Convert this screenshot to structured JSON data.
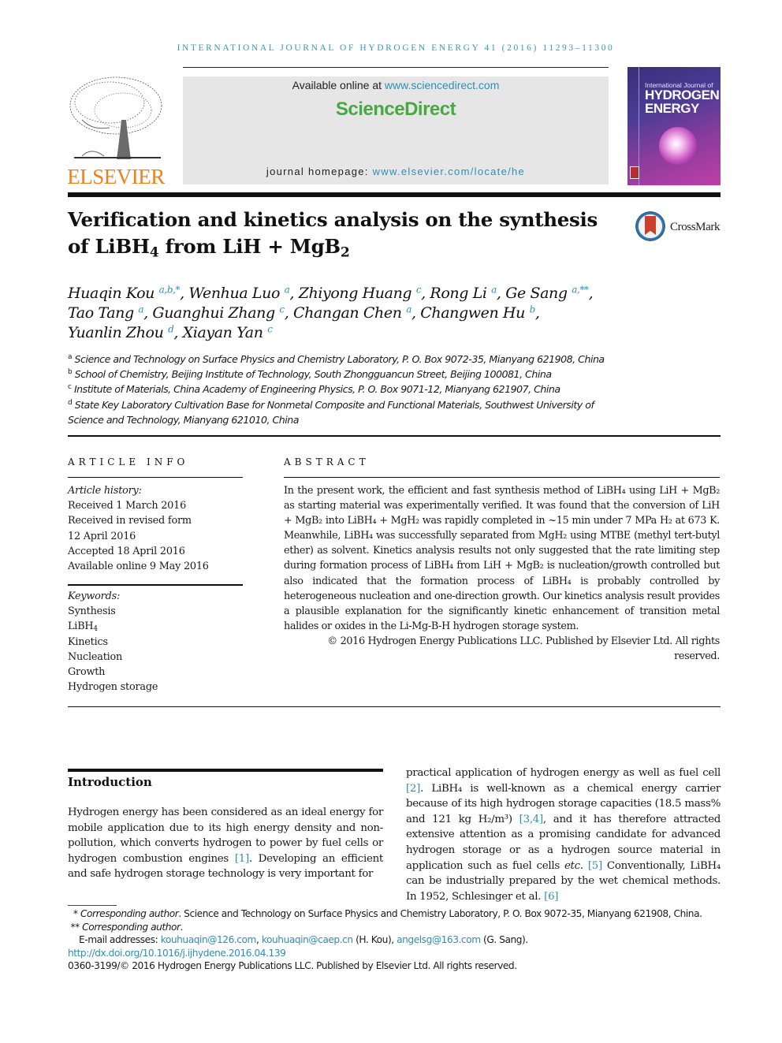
{
  "running_head": "INTERNATIONAL JOURNAL OF HYDROGEN ENERGY 41 (2016) 11293–11300",
  "masthead": {
    "publisher_logo": "ELSEVIER",
    "available_online_prefix": "Available online at ",
    "available_online_link": "www.sciencedirect.com",
    "brand": "ScienceDirect",
    "homepage_prefix": "journal homepage: ",
    "homepage_link": "www.elsevier.com/locate/he",
    "cover": {
      "line1": "International Journal of",
      "line2": "HYDROGEN",
      "line3": "ENERGY"
    },
    "colors": {
      "link": "#2e8fb5",
      "brand_green": "#48a842",
      "elsevier_orange": "#f07f1a"
    }
  },
  "article": {
    "title_part1": "Verification and kinetics analysis on the synthesis of LiBH",
    "title_sub1": "4",
    "title_part2": " from LiH + MgB",
    "title_sub2": "2",
    "crossmark_label": "CrossMark",
    "authors": [
      {
        "name": "Huaqin Kou",
        "aff": "a,b,*",
        "sep": ", "
      },
      {
        "name": "Wenhua Luo",
        "aff": "a",
        "sep": ", "
      },
      {
        "name": "Zhiyong Huang",
        "aff": "c",
        "sep": ", "
      },
      {
        "name": "Rong Li",
        "aff": "a",
        "sep": ", "
      },
      {
        "name": "Ge Sang",
        "aff": "a,**",
        "sep": ","
      },
      {
        "name": "Tao Tang",
        "aff": "a",
        "sep": ", "
      },
      {
        "name": "Guanghui Zhang",
        "aff": "c",
        "sep": ", "
      },
      {
        "name": "Changan Chen",
        "aff": "a",
        "sep": ", "
      },
      {
        "name": "Changwen Hu",
        "aff": "b",
        "sep": ","
      },
      {
        "name": "Yuanlin Zhou",
        "aff": "d",
        "sep": ", "
      },
      {
        "name": "Xiayan Yan",
        "aff": "c",
        "sep": ""
      }
    ],
    "affiliations": [
      {
        "key": "a",
        "text": "Science and Technology on Surface Physics and Chemistry Laboratory, P. O. Box 9072-35, Mianyang 621908, China"
      },
      {
        "key": "b",
        "text": "School of Chemistry, Beijing Institute of Technology, South Zhongguancun Street, Beijing 100081, China"
      },
      {
        "key": "c",
        "text": "Institute of Materials, China Academy of Engineering Physics, P. O. Box 9071-12, Mianyang 621907, China"
      },
      {
        "key": "d",
        "text": "State Key Laboratory Cultivation Base for Nonmetal Composite and Functional Materials, Southwest University of Science and Technology, Mianyang 621010, China"
      }
    ]
  },
  "article_info": {
    "heading": "ARTICLE INFO",
    "history_label": "Article history:",
    "history": [
      "Received 1 March 2016",
      "Received in revised form",
      "12 April 2016",
      "Accepted 18 April 2016",
      "Available online 9 May 2016"
    ],
    "keywords_label": "Keywords:",
    "keywords": [
      "Synthesis",
      "LiBH4",
      "Kinetics",
      "Nucleation",
      "Growth",
      "Hydrogen storage"
    ]
  },
  "abstract": {
    "heading": "ABSTRACT",
    "text": "In the present work, the efficient and fast synthesis method of LiBH₄ using LiH + MgB₂ as starting material was experimentally verified. It was found that the conversion of LiH + MgB₂ into LiBH₄ + MgH₂ was rapidly completed in ~15 min under 7 MPa H₂ at 673 K. Meanwhile, LiBH₄ was successfully separated from MgH₂ using MTBE (methyl tert-butyl ether) as solvent. Kinetics analysis results not only suggested that the rate limiting step during formation process of LiBH₄ from LiH + MgB₂ is nucleation/growth controlled but also indicated that the formation process of LiBH₄ is probably controlled by heterogeneous nucleation and one-direction growth. Our kinetics analysis result provides a plausible explanation for the significantly kinetic enhancement of transition metal halides or oxides in the Li-Mg-B-H hydrogen storage system.",
    "copyright": "© 2016 Hydrogen Energy Publications LLC. Published by Elsevier Ltd. All rights reserved."
  },
  "introduction": {
    "heading": "Introduction",
    "left_p1": "Hydrogen energy has been considered as an ideal energy for mobile application due to its high energy density and non-pollution, which converts hydrogen to power by fuel cells or hydrogen combustion engines ",
    "left_ref1": "[1]",
    "left_p2": ". Developing an efficient and safe hydrogen storage technology is very important for",
    "right_p1": "practical application of hydrogen energy as well as fuel cell ",
    "right_ref2": "[2]",
    "right_p2": ". LiBH₄ is well-known as a chemical energy carrier because of its high hydrogen storage capacities (18.5 mass% and 121 kg H₂/m³) ",
    "right_ref34": "[3,4]",
    "right_p3": ", and it has therefore attracted extensive attention as a promising candidate for advanced hydrogen storage or as a hydrogen source material in application such as fuel cells ",
    "right_etc": "etc.",
    "right_ref5": "[5]",
    "right_p4": " Conventionally, LiBH₄ can be industrially prepared by the wet chemical methods. In 1952, Schlesinger et al. ",
    "right_ref6": "[6]"
  },
  "footnotes": {
    "fn1_mark": "*",
    "fn1_label": "Corresponding author",
    "fn1_text": ". Science and Technology on Surface Physics and Chemistry Laboratory, P. O. Box 9072-35, Mianyang 621908, China.",
    "fn2_mark": "**",
    "fn2_label": "Corresponding author",
    "fn2_text": ".",
    "email_prefix": "E-mail addresses: ",
    "email1": "kouhuaqin@126.com",
    "email2": "kouhuaqin@caep.cn",
    "email_kou": " (H. Kou), ",
    "email3": "angelsg@163.com",
    "email_sang": " (G. Sang).",
    "doi": "http://dx.doi.org/10.1016/j.ijhydene.2016.04.139",
    "issn_copyright": "0360-3199/© 2016 Hydrogen Energy Publications LLC. Published by Elsevier Ltd. All rights reserved."
  }
}
